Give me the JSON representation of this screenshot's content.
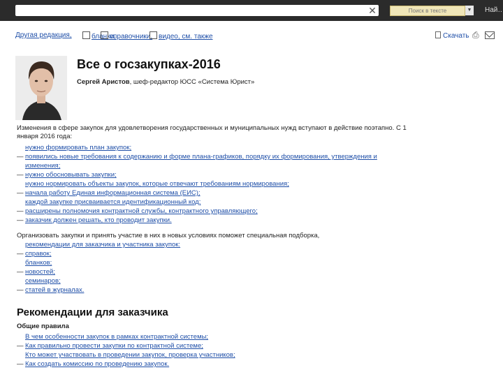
{
  "topbar": {
    "url_value": "",
    "clear_glyph": "✕",
    "search_placeholder": "Поиск в тексте",
    "dropdown_glyph": "▼",
    "next_label": "Най…"
  },
  "toolbar": {
    "items": [
      {
        "label": "Другая редакция,",
        "icon": "document-icon"
      },
      {
        "label": "бланки,",
        "icon": "form-icon"
      },
      {
        "label": "справочники,",
        "icon": "book-icon"
      },
      {
        "label": "видео, см. также",
        "icon": "video-icon"
      }
    ],
    "download_label": "Скачать",
    "print_icon": "print-icon",
    "mail_icon": "mail-icon"
  },
  "header": {
    "title": "Все о госзакупках-2016",
    "author_name": "Сергей Аристов",
    "author_role": ", шеф-редактор ЮСС «Система Юрист»"
  },
  "intro": {
    "text": "Изменения в сфере закупок для удовлетворения государственных и муниципальных нужд вступают в действие поэтапно. С 1 января 2016 года:",
    "items": [
      {
        "dash": false,
        "text": "нужно формировать план закупок;"
      },
      {
        "dash": true,
        "text": "появились новые требования к содержанию и форме плана-графиков, порядку их формирования, утверждения и"
      },
      {
        "dash": false,
        "text": "изменения;"
      },
      {
        "dash": true,
        "text": "нужно обосновывать закупки;"
      },
      {
        "dash": false,
        "text": "нужно нормировать объекты закупок, которые отвечают требованиям нормирования;"
      },
      {
        "dash": true,
        "text": "начала работу Единая информационная система (ЕИС);"
      },
      {
        "dash": false,
        "text": "каждой закупке присваивается идентификационный код;"
      },
      {
        "dash": true,
        "text": "расширены полномочия контрактной службы, контрактного управляющего;"
      },
      {
        "dash": true,
        "text": "заказчик должен решать, кто проводит закупки."
      }
    ]
  },
  "selection": {
    "text1": "Организовать закупки и принять участие в них в новых условиях поможет специальная подборка,",
    "text2": "рекомендации для заказчика и участника закупок:",
    "items": [
      {
        "dash": true,
        "text": "справок;"
      },
      {
        "dash": false,
        "text": "бланков;"
      },
      {
        "dash": true,
        "text": "новостей;"
      },
      {
        "dash": false,
        "text": "семинаров;"
      },
      {
        "dash": true,
        "text": "статей в журналах."
      }
    ]
  },
  "recommendations": {
    "title": "Рекомендации для заказчика",
    "subhead": "Общие правила",
    "items": [
      {
        "dash": false,
        "text": "В чем особенности закупок в рамках контрактной системы;"
      },
      {
        "dash": true,
        "text": "Как правильно провести закупки по контрактной системе;"
      },
      {
        "dash": false,
        "text": "Кто может участвовать в проведении закупок, проверка участников;"
      },
      {
        "dash": true,
        "text": "Как создать комиссию по проведению закупок."
      }
    ]
  },
  "colors": {
    "link": "#1f4fa8",
    "topbar": "#2b2b2b",
    "search_bg": "#f0e6b8"
  }
}
